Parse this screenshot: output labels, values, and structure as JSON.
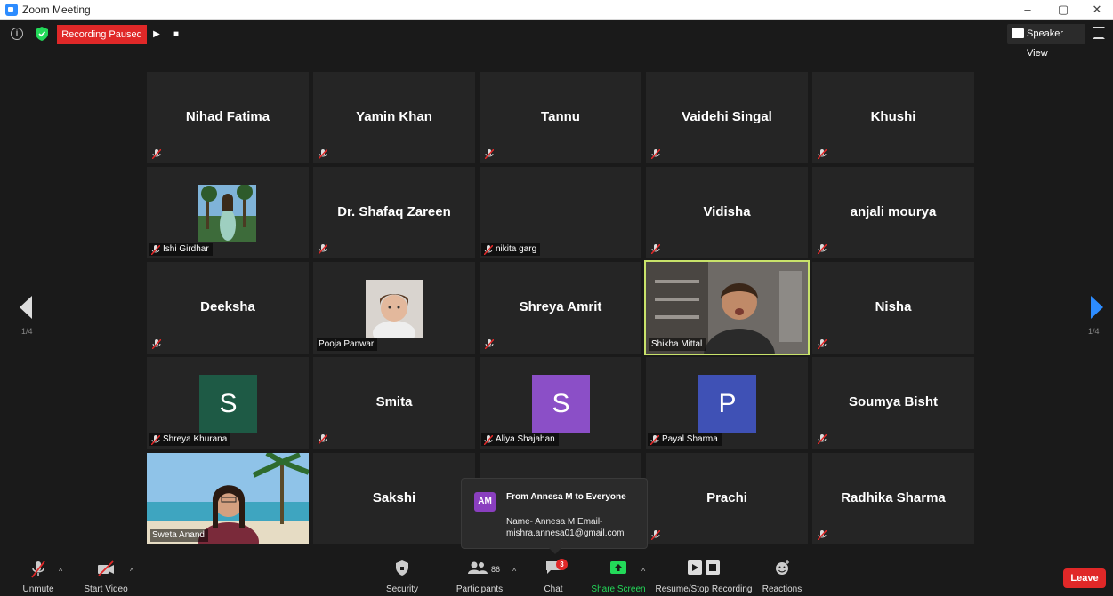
{
  "window": {
    "title": "Zoom Meeting",
    "minimize": "–",
    "maximize": "▢",
    "close": "✕"
  },
  "topbar": {
    "recording_status": "Recording Paused",
    "resume_glyph": "▶",
    "stop_glyph": "■",
    "view_mode": "Speaker View"
  },
  "navigation": {
    "page_left": "1/4",
    "page_right": "1/4"
  },
  "participants": [
    {
      "row": 0,
      "col": 0,
      "display": "Nihad Fatima",
      "label": "",
      "muted": true
    },
    {
      "row": 0,
      "col": 1,
      "display": "Yamin Khan",
      "label": "",
      "muted": true
    },
    {
      "row": 0,
      "col": 2,
      "display": "Tannu",
      "label": "",
      "muted": true
    },
    {
      "row": 0,
      "col": 3,
      "display": "Vaidehi Singal",
      "label": "",
      "muted": true
    },
    {
      "row": 0,
      "col": 4,
      "display": "Khushi",
      "label": "",
      "muted": true
    },
    {
      "row": 1,
      "col": 0,
      "display": "",
      "label": "Ishi Girdhar",
      "muted": true,
      "photo": "beach-photo"
    },
    {
      "row": 1,
      "col": 1,
      "display": "Dr. Shafaq Zareen",
      "label": "",
      "muted": true
    },
    {
      "row": 1,
      "col": 2,
      "display": "",
      "label": "nikita garg",
      "muted": true
    },
    {
      "row": 1,
      "col": 3,
      "display": "Vidisha",
      "label": "",
      "muted": true
    },
    {
      "row": 1,
      "col": 4,
      "display": "anjali mourya",
      "label": "",
      "muted": true
    },
    {
      "row": 2,
      "col": 0,
      "display": "Deeksha",
      "label": "",
      "muted": true
    },
    {
      "row": 2,
      "col": 1,
      "display": "",
      "label": "Pooja Panwar",
      "muted": false,
      "photo": "portrait-photo"
    },
    {
      "row": 2,
      "col": 2,
      "display": "Shreya Amrit",
      "label": "",
      "muted": true
    },
    {
      "row": 2,
      "col": 3,
      "display": "",
      "label": "Shikha Mittal",
      "muted": false,
      "video": "speaker-video",
      "active": true
    },
    {
      "row": 2,
      "col": 4,
      "display": "Nisha",
      "label": "",
      "muted": true
    },
    {
      "row": 3,
      "col": 0,
      "display": "",
      "label": "Shreya Khurana",
      "muted": true,
      "letter": "S",
      "letter_color": "#1e5a45"
    },
    {
      "row": 3,
      "col": 1,
      "display": "Smita",
      "label": "",
      "muted": true
    },
    {
      "row": 3,
      "col": 2,
      "display": "",
      "label": "Aliya Shajahan",
      "muted": true,
      "letter": "S",
      "letter_color": "#8b4fc7"
    },
    {
      "row": 3,
      "col": 3,
      "display": "",
      "label": "Payal Sharma",
      "muted": true,
      "letter": "P",
      "letter_color": "#3f51b5"
    },
    {
      "row": 3,
      "col": 4,
      "display": "Soumya Bisht",
      "label": "",
      "muted": true
    },
    {
      "row": 4,
      "col": 0,
      "display": "",
      "label": "Sweta Anand",
      "muted": false,
      "video": "beach-video"
    },
    {
      "row": 4,
      "col": 1,
      "display": "Sakshi",
      "label": "",
      "muted": false
    },
    {
      "row": 4,
      "col": 2,
      "display": "",
      "label": "",
      "muted": false
    },
    {
      "row": 4,
      "col": 3,
      "display": "Prachi",
      "label": "",
      "muted": true
    },
    {
      "row": 4,
      "col": 4,
      "display": "Radhika Sharma",
      "label": "",
      "muted": true
    }
  ],
  "chat_popup": {
    "avatar": "AM",
    "from": "From Annesa M to Everyone",
    "message": "Name- Annesa M Email- mishra.annesa01@gmail.com"
  },
  "toolbar": {
    "unmute": "Unmute",
    "start_video": "Start Video",
    "security": "Security",
    "participants": "Participants",
    "participants_count": "86",
    "chat": "Chat",
    "chat_unread": "3",
    "share_screen": "Share Screen",
    "recording": "Resume/Stop Recording",
    "reactions": "Reactions",
    "leave": "Leave",
    "caret": "^"
  },
  "colors": {
    "accent_green": "#23d959",
    "record_red": "#e02828",
    "active_speaker": "#c8e26a",
    "mute_red": "#e02828"
  }
}
